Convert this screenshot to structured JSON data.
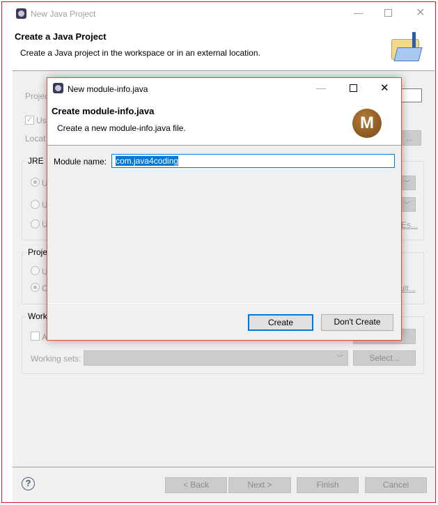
{
  "outer": {
    "title": "New Java Project",
    "header_title": "Create a Java Project",
    "header_desc": "Create a Java project in the workspace or in an external location.",
    "project_name_label": "Projec",
    "use_default_label": "Us",
    "location_label": "Locat",
    "jre_group": "JRE",
    "jre_radio_labels": [
      "U",
      "U",
      "U"
    ],
    "configure_jres_link": "Es...",
    "project_layout_group": "Proje",
    "layout_radio_labels": [
      "U",
      "C"
    ],
    "configure_default_link": "ult...",
    "working_sets_group": "Work",
    "add_to_ws_label": "A",
    "working_sets_label": "Working sets:",
    "select_button": "Select...",
    "browse_button": "...",
    "buttons": {
      "back": "< Back",
      "next": "Next >",
      "finish": "Finish",
      "cancel": "Cancel"
    }
  },
  "dialog": {
    "title": "New module-info.java",
    "header_title": "Create module-info.java",
    "header_desc": "Create a new module-info.java file.",
    "module_name_label": "Module name:",
    "module_name_value": "com.java4coding",
    "create_button": "Create",
    "dont_create_button": "Don't Create",
    "logo_letter": "M"
  },
  "colors": {
    "accent": "#0078d7",
    "close_border": "#e81123",
    "logo": "#8b5a1e"
  }
}
